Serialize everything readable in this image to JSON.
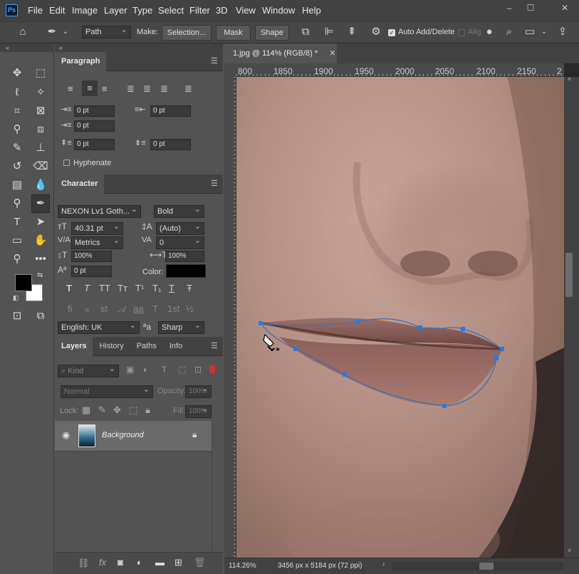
{
  "app": {
    "logo": "Ps",
    "window_buttons": [
      "–",
      "☐",
      "✕"
    ]
  },
  "menu": [
    "File",
    "Edit",
    "Image",
    "Layer",
    "Type",
    "Select",
    "Filter",
    "3D",
    "View",
    "Window",
    "Help"
  ],
  "options": {
    "mode_value": "Path",
    "make_label": "Make:",
    "selection_label": "Selection...",
    "mask_label": "Mask",
    "shape_label": "Shape",
    "auto_add_label": "Auto Add/Delete",
    "auto_add_checked": true,
    "align_label": "Alig"
  },
  "paragraph": {
    "title": "Paragraph",
    "indent_left": "0 pt",
    "indent_right": "0 pt",
    "first_line": "0 pt",
    "space_before": "0 pt",
    "space_after": "0 pt",
    "hyphenate": "Hyphenate"
  },
  "character": {
    "title": "Character",
    "font": "NEXON Lv1 Goth...",
    "style": "Bold",
    "size": "40.31 pt",
    "leading": "(Auto)",
    "kerning": "Metrics",
    "tracking": "0",
    "vscale": "100%",
    "hscale": "100%",
    "baseline": "0 pt",
    "color_label": "Color:",
    "color": "#000000",
    "language": "English: UK",
    "aa_glyph": "ªa",
    "antialias": "Sharp",
    "style_buttons": [
      "T",
      "T",
      "TT",
      "Tт",
      "T¹",
      "T₁",
      "T",
      "Ŧ"
    ],
    "ot_buttons": [
      "fi",
      "ℴ",
      "st",
      "𝒜",
      "aa",
      "T",
      "1st",
      "½"
    ]
  },
  "layers": {
    "tabs": [
      "Layers",
      "History",
      "Paths",
      "Info"
    ],
    "kind_label": "Kind",
    "blend_mode": "Normal",
    "opacity_label": "Opacity:",
    "opacity": "100%",
    "lock_label": "Lock:",
    "fill_label": "Fill:",
    "fill": "100%",
    "items": [
      {
        "name": "Background",
        "visible": true,
        "locked": true
      }
    ]
  },
  "document": {
    "tab_title": "1.jpg @ 114% (RGB/8) *",
    "ruler_top": [
      "800",
      "1850",
      "1900",
      "1950",
      "2000",
      "2050",
      "2100",
      "2150",
      "2"
    ],
    "zoom": "114.26%",
    "doc_info": "3456 px x 5184 px (72 ppi)"
  },
  "colors": {
    "accent": "#31a8ff",
    "path": "#3a6fb8",
    "anchor": "#1f7cf0",
    "ui_dark": "#424242",
    "ui_mid": "#535353"
  }
}
